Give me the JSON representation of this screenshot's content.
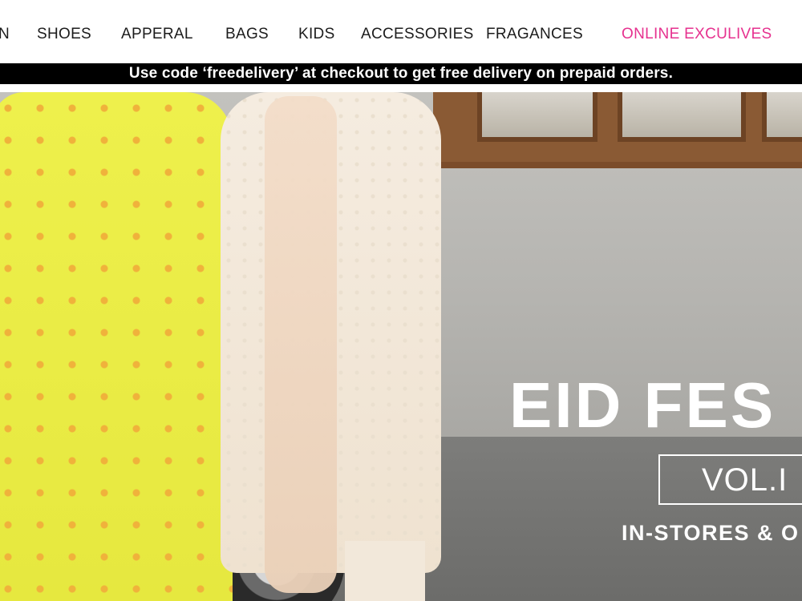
{
  "nav": {
    "items": [
      {
        "label": "N"
      },
      {
        "label": "SHOES"
      },
      {
        "label": "APPERAL"
      },
      {
        "label": "BAGS"
      },
      {
        "label": "KIDS"
      },
      {
        "label": "ACCESSORIES"
      },
      {
        "label": "FRAGANCES"
      },
      {
        "label": "ONLINE EXCULIVES"
      }
    ],
    "highlight_color": "#e6328f"
  },
  "promo": {
    "text": "Use code ‘freedelivery’ at checkout to get free delivery on prepaid orders."
  },
  "hero": {
    "headline": "EID FES",
    "volume": "VOL.I",
    "subline": "IN-STORES & O"
  }
}
